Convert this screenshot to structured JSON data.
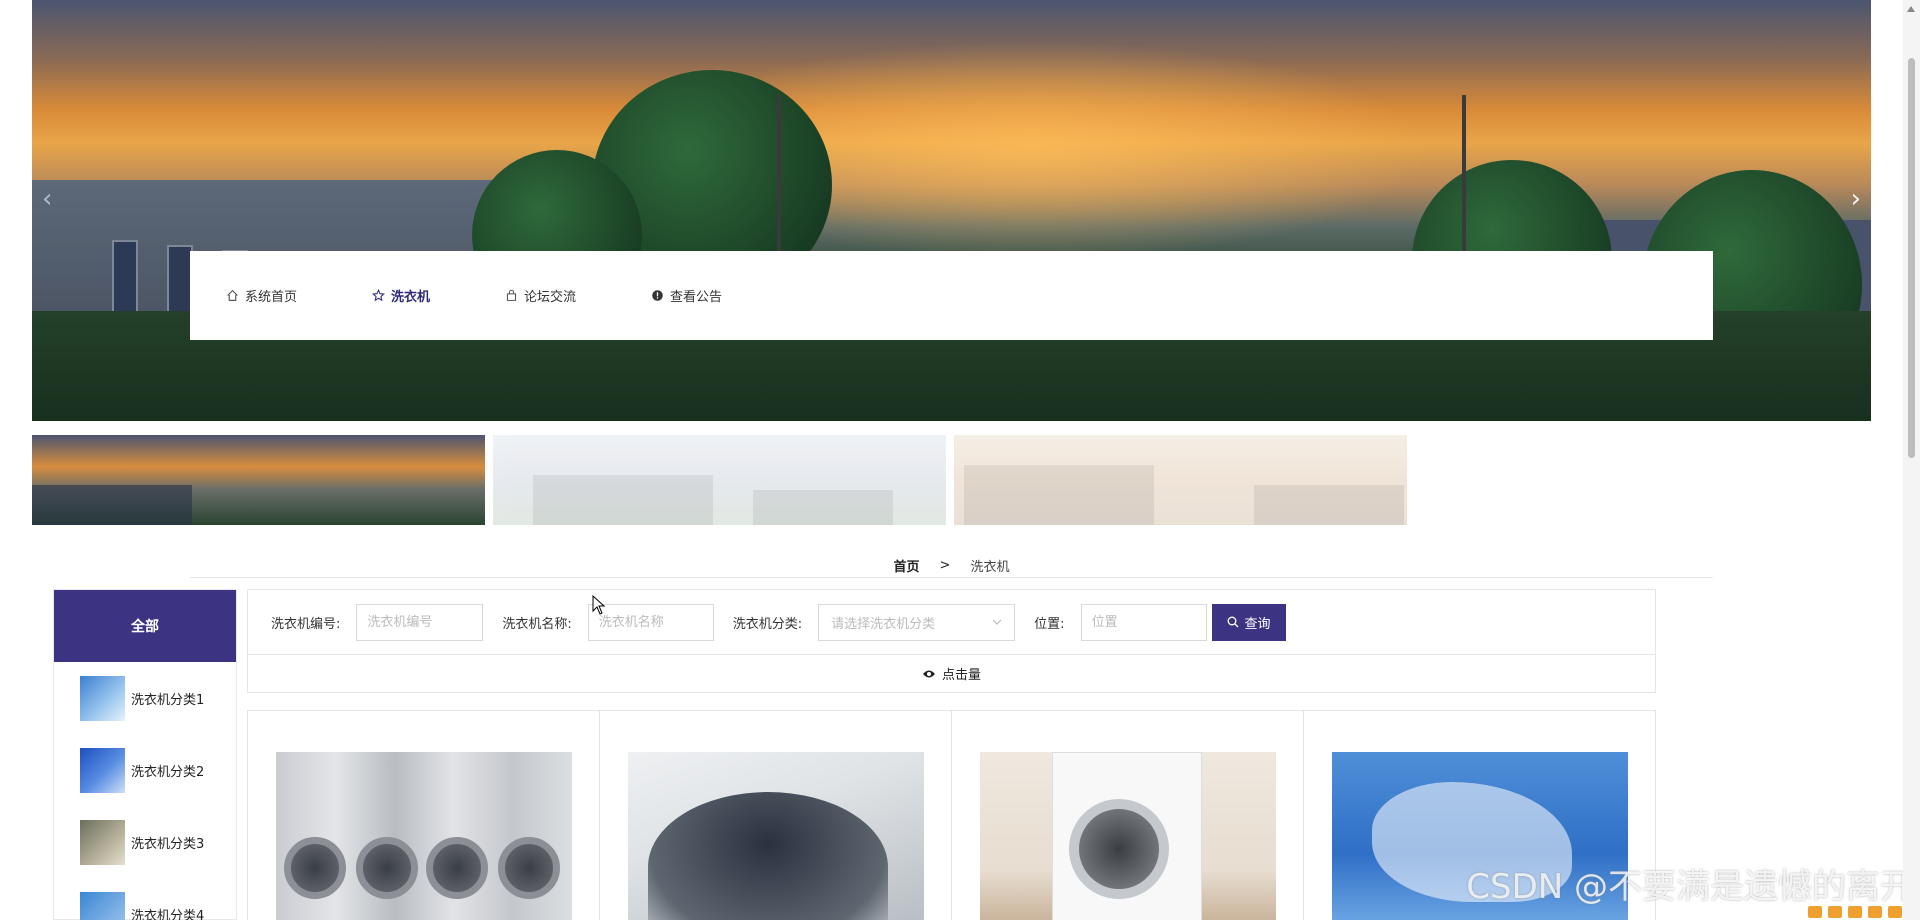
{
  "nav": {
    "items": [
      {
        "label": "系统首页",
        "icon": "home-icon",
        "active": false
      },
      {
        "label": "洗衣机",
        "icon": "star-icon",
        "active": true
      },
      {
        "label": "论坛交流",
        "icon": "bag-icon",
        "active": false
      },
      {
        "label": "查看公告",
        "icon": "info-icon",
        "active": false
      }
    ]
  },
  "breadcrumb": {
    "home": "首页",
    "separator": ">",
    "current": "洗衣机"
  },
  "sidebar": {
    "all_label": "全部",
    "items": [
      {
        "label": "洗衣机分类1"
      },
      {
        "label": "洗衣机分类2"
      },
      {
        "label": "洗衣机分类3"
      },
      {
        "label": "洗衣机分类4"
      }
    ]
  },
  "filter": {
    "code_label": "洗衣机编号:",
    "code_placeholder": "洗衣机编号",
    "name_label": "洗衣机名称:",
    "name_placeholder": "洗衣机名称",
    "category_label": "洗衣机分类:",
    "category_placeholder": "请选择洗衣机分类",
    "position_label": "位置:",
    "position_placeholder": "位置",
    "search_button": "查询"
  },
  "sort": {
    "views_label": "点击量"
  },
  "watermark": "CSDN @不要满是遗憾的离开",
  "colors": {
    "accent": "#3d3383",
    "nav_active": "#2f2a78"
  }
}
